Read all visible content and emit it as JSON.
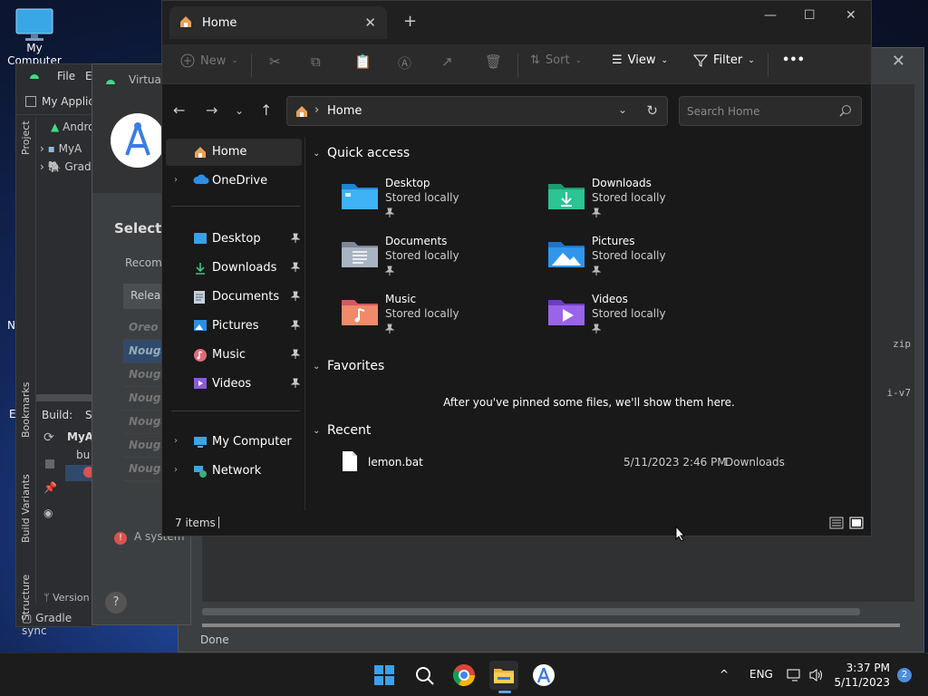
{
  "desktop": {
    "icons": [
      {
        "label": "My Computer"
      }
    ],
    "edge_letters": [
      "N",
      "E"
    ]
  },
  "android_studio": {
    "menu": [
      "File",
      "E"
    ],
    "project_label": "My Applic",
    "tree": [
      "Andro",
      "MyA",
      "Grad"
    ],
    "side_tabs": [
      "Project",
      "Bookmarks",
      "Build Variants",
      "Structure"
    ],
    "build_label": "Build:",
    "build_tab": "S",
    "build_item": "MyAp",
    "build_sub": "bu",
    "version_label": "Version",
    "gradle_status": "Gradle sync"
  },
  "virtual_device": {
    "title": "Virtua",
    "heading": "Select",
    "recommended": "Recom",
    "release_header": "Releas",
    "rows": [
      "Oreo",
      "Nouga",
      "Nouga",
      "Nouga",
      "Nouga",
      "Nouga",
      "Nouga"
    ],
    "warning": "A system",
    "help": "?"
  },
  "right_window": {
    "side_text_1": "zip",
    "side_text_2": "i-v7",
    "status": "Done"
  },
  "explorer": {
    "tab_title": "Home",
    "toolbar": {
      "new_label": "New",
      "sort_label": "Sort",
      "view_label": "View",
      "filter_label": "Filter",
      "more_label": "•••"
    },
    "address": {
      "crumb": "Home"
    },
    "search": {
      "placeholder": "Search Home"
    },
    "nav": {
      "home": "Home",
      "onedrive": "OneDrive",
      "desktop": "Desktop",
      "downloads": "Downloads",
      "documents": "Documents",
      "pictures": "Pictures",
      "music": "Music",
      "videos": "Videos",
      "my_computer": "My Computer",
      "network": "Network"
    },
    "sections": {
      "quick_access": "Quick access",
      "favorites": "Favorites",
      "recent": "Recent"
    },
    "quick_access": [
      {
        "name": "Desktop",
        "sub": "Stored locally"
      },
      {
        "name": "Downloads",
        "sub": "Stored locally"
      },
      {
        "name": "Documents",
        "sub": "Stored locally"
      },
      {
        "name": "Pictures",
        "sub": "Stored locally"
      },
      {
        "name": "Music",
        "sub": "Stored locally"
      },
      {
        "name": "Videos",
        "sub": "Stored locally"
      }
    ],
    "favorites_empty": "After you've pinned some files, we'll show them here.",
    "recent": [
      {
        "name": "lemon.bat",
        "date": "5/11/2023 2:46 PM",
        "location": "Downloads"
      }
    ],
    "status_count": "7 items"
  },
  "taskbar": {
    "language": "ENG",
    "time": "3:37 PM",
    "date": "5/11/2023",
    "notifications": "2"
  }
}
